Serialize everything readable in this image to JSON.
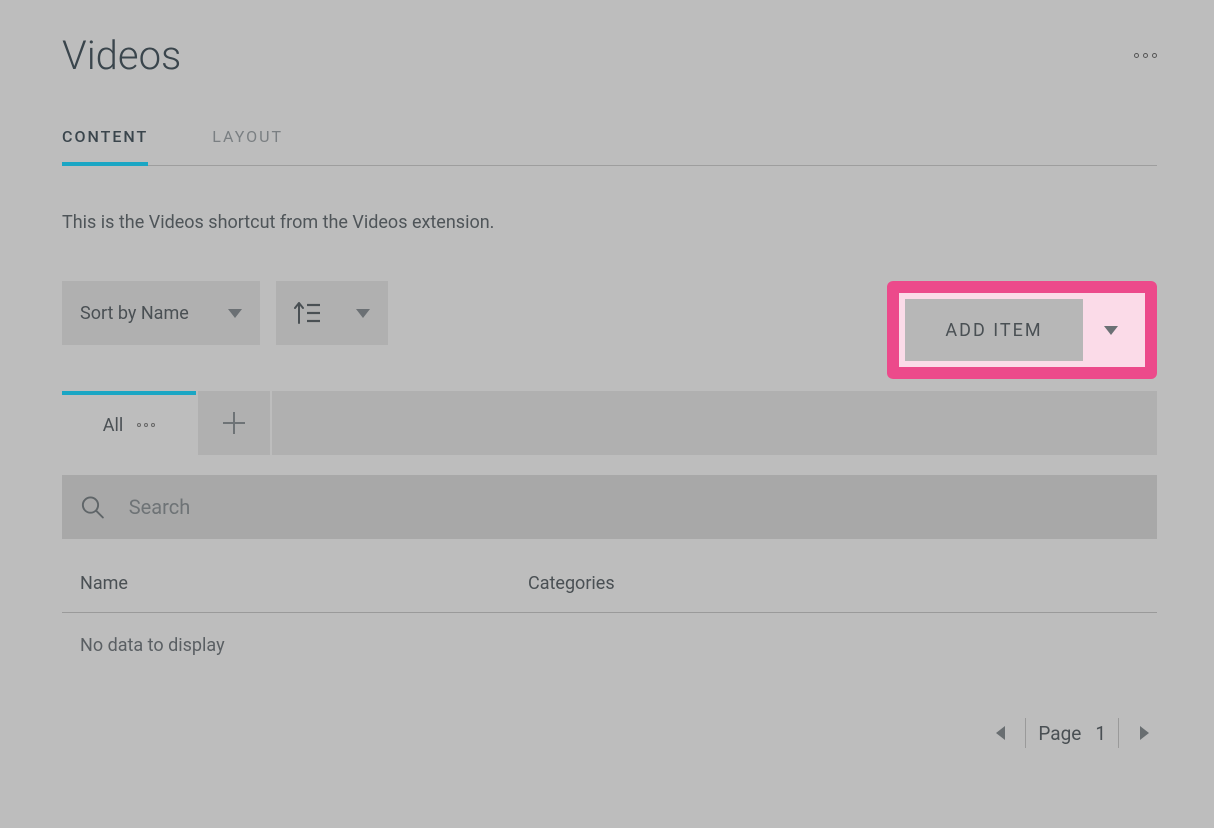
{
  "header": {
    "title": "Videos"
  },
  "tabs": [
    {
      "label": "CONTENT",
      "active": true
    },
    {
      "label": "LAYOUT",
      "active": false
    }
  ],
  "description": "This is the Videos shortcut from the Videos extension.",
  "controls": {
    "sort_label": "Sort by Name",
    "add_item_label": "ADD ITEM"
  },
  "subtabs": {
    "all_label": "All"
  },
  "search": {
    "placeholder": "Search"
  },
  "table": {
    "columns": [
      "Name",
      "Categories"
    ],
    "empty_message": "No data to display"
  },
  "pagination": {
    "label": "Page",
    "current": "1"
  }
}
